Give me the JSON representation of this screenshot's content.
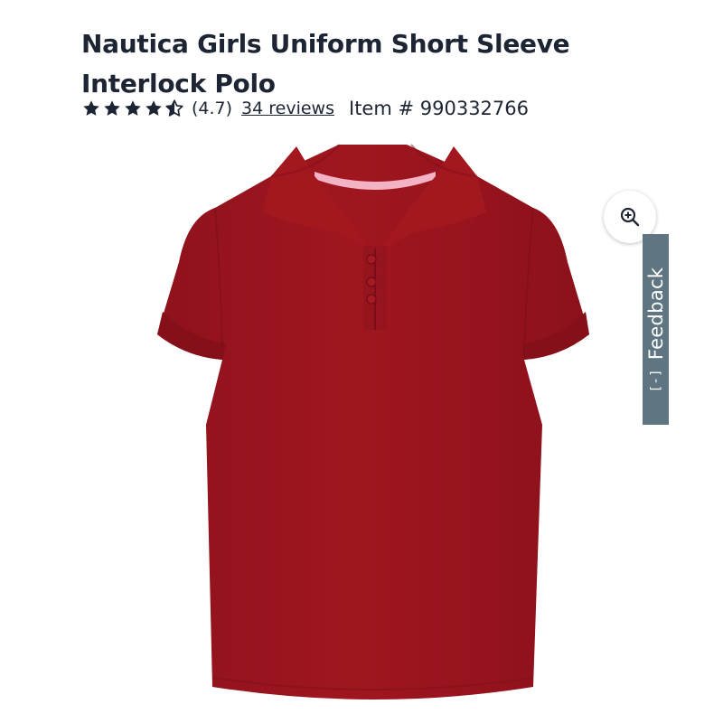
{
  "product": {
    "title": "Nautica Girls Uniform Short Sleeve Interlock Polo",
    "rating_value": "(4.7)",
    "reviews_link": "34 reviews",
    "item_number": "Item # 990332766",
    "star_rating": 4.5,
    "garment_color": "#9a1520",
    "collar_trim_color": "#f4b3c5"
  },
  "icons": {
    "zoom": "zoom-in-icon",
    "feedback": "expand-bracket-icon"
  },
  "feedback": {
    "label": "Feedback",
    "icon_text": "[-]"
  }
}
